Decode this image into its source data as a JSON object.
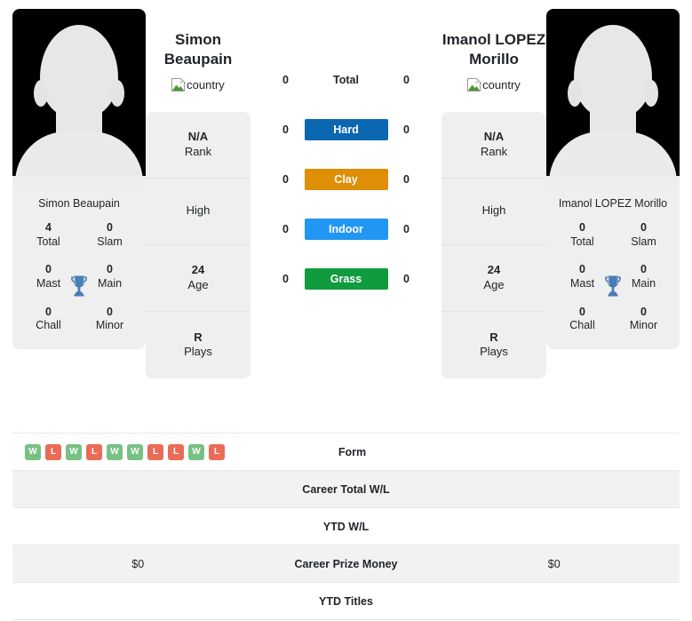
{
  "players": {
    "left": {
      "name": "Simon Beaupain",
      "name_line1": "Simon",
      "name_line2": "Beaupain",
      "caption": "Simon Beaupain",
      "flag_alt": "country",
      "titles": [
        {
          "value": "4",
          "label": "Total"
        },
        {
          "value": "0",
          "label": "Slam"
        },
        {
          "value": "0",
          "label": "Mast"
        },
        {
          "value": "0",
          "label": "Main"
        },
        {
          "value": "0",
          "label": "Chall"
        },
        {
          "value": "0",
          "label": "Minor"
        }
      ],
      "info": [
        {
          "value": "N/A",
          "label": "Rank"
        },
        {
          "value": "",
          "label": "High"
        },
        {
          "value": "24",
          "label": "Age"
        },
        {
          "value": "R",
          "label": "Plays"
        }
      ]
    },
    "right": {
      "name": "Imanol LOPEZ Morillo",
      "name_line1": "Imanol LOPEZ",
      "name_line2": "Morillo",
      "caption": "Imanol LOPEZ Morillo",
      "flag_alt": "country",
      "titles": [
        {
          "value": "0",
          "label": "Total"
        },
        {
          "value": "0",
          "label": "Slam"
        },
        {
          "value": "0",
          "label": "Mast"
        },
        {
          "value": "0",
          "label": "Main"
        },
        {
          "value": "0",
          "label": "Chall"
        },
        {
          "value": "0",
          "label": "Minor"
        }
      ],
      "info": [
        {
          "value": "N/A",
          "label": "Rank"
        },
        {
          "value": "",
          "label": "High"
        },
        {
          "value": "24",
          "label": "Age"
        },
        {
          "value": "R",
          "label": "Plays"
        }
      ]
    }
  },
  "head_to_head": {
    "rows": [
      {
        "label": "Total",
        "left": "0",
        "right": "0",
        "badge": false,
        "color": ""
      },
      {
        "label": "Hard",
        "left": "0",
        "right": "0",
        "badge": true,
        "color": "#0b67b2"
      },
      {
        "label": "Clay",
        "left": "0",
        "right": "0",
        "badge": true,
        "color": "#df8e08"
      },
      {
        "label": "Indoor",
        "left": "0",
        "right": "0",
        "badge": true,
        "color": "#2196f3"
      },
      {
        "label": "Grass",
        "left": "0",
        "right": "0",
        "badge": true,
        "color": "#0f9b3e"
      }
    ]
  },
  "stats_table": {
    "rows": [
      {
        "label": "Form",
        "left": "",
        "right": "",
        "type": "form"
      },
      {
        "label": "Career Total W/L",
        "left": "",
        "right": "",
        "type": "text"
      },
      {
        "label": "YTD W/L",
        "left": "",
        "right": "",
        "type": "text"
      },
      {
        "label": "Career Prize Money",
        "left": "$0",
        "right": "$0",
        "type": "text"
      },
      {
        "label": "YTD Titles",
        "left": "",
        "right": "",
        "type": "text"
      }
    ],
    "form_left": [
      "W",
      "L",
      "W",
      "L",
      "W",
      "W",
      "L",
      "L",
      "W",
      "L"
    ],
    "form_right": [],
    "form_colors": {
      "W": "#78c184",
      "L": "#eb6b56"
    }
  }
}
